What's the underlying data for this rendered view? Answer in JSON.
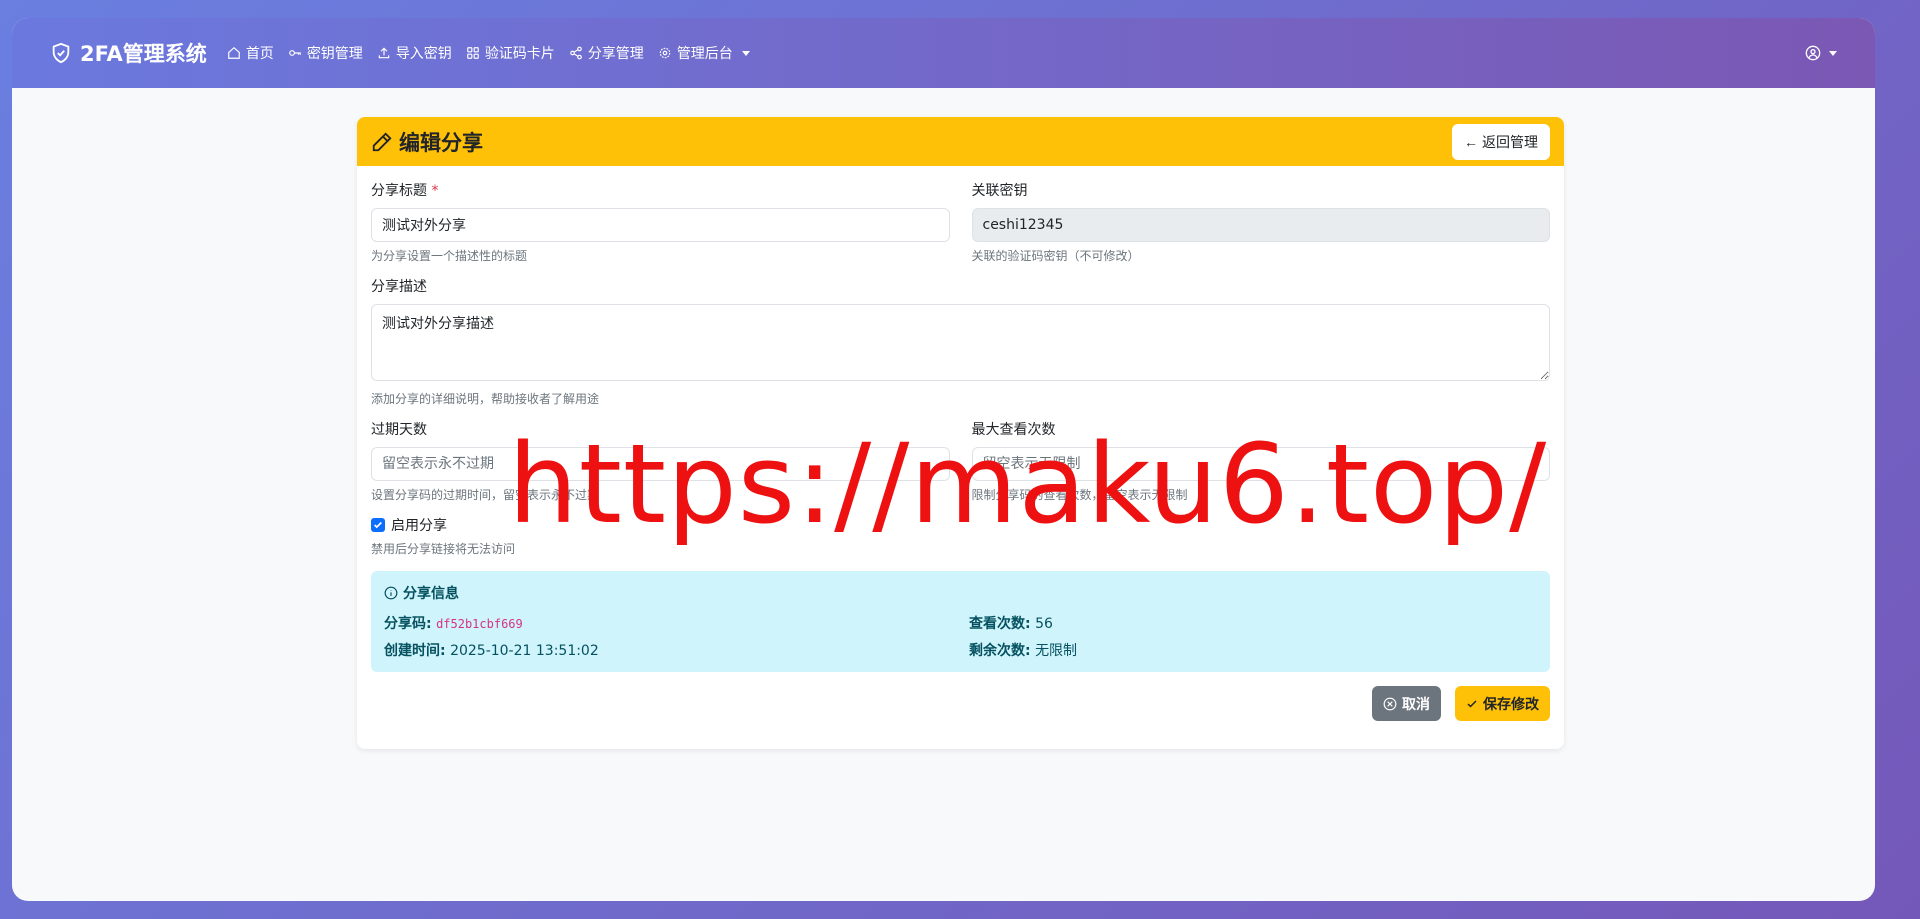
{
  "navbar": {
    "brand": "2FA管理系统",
    "items": [
      {
        "label": "首页",
        "icon": "home-icon"
      },
      {
        "label": "密钥管理",
        "icon": "key-icon"
      },
      {
        "label": "导入密钥",
        "icon": "upload-icon"
      },
      {
        "label": "验证码卡片",
        "icon": "grid-icon"
      },
      {
        "label": "分享管理",
        "icon": "share-icon"
      },
      {
        "label": "管理后台",
        "icon": "gear-icon"
      }
    ]
  },
  "card": {
    "title": "编辑分享",
    "back_label": "返回管理"
  },
  "form": {
    "share_title": {
      "label": "分享标题",
      "required_mark": "*",
      "value": "测试对外分享",
      "help": "为分享设置一个描述性的标题"
    },
    "linked_key": {
      "label": "关联密钥",
      "value": "ceshi12345",
      "help": "关联的验证码密钥（不可修改）"
    },
    "description": {
      "label": "分享描述",
      "value": "测试对外分享描述",
      "help": "添加分享的详细说明，帮助接收者了解用途"
    },
    "expire_days": {
      "label": "过期天数",
      "placeholder": "留空表示永不过期",
      "help": "设置分享码的过期时间，留空表示永不过期"
    },
    "max_views": {
      "label": "最大查看次数",
      "placeholder": "留空表示无限制",
      "help": "限制分享码的查看次数，留空表示无限制"
    },
    "enable": {
      "label": "启用分享",
      "checked": true,
      "help": "禁用后分享链接将无法访问"
    }
  },
  "info": {
    "title": "分享信息",
    "share_code_label": "分享码:",
    "share_code": "df52b1cbf669",
    "view_count_label": "查看次数:",
    "view_count": "56",
    "created_label": "创建时间:",
    "created": "2025-10-21 13:51:02",
    "remaining_label": "剩余次数:",
    "remaining": "无限制"
  },
  "actions": {
    "cancel_label": "取消",
    "save_label": "保存修改"
  },
  "watermark": "https://maku6.top/",
  "colors": {
    "header": "#ffc107",
    "info_bg": "#cff4fc",
    "watermark": "#ee1111"
  }
}
